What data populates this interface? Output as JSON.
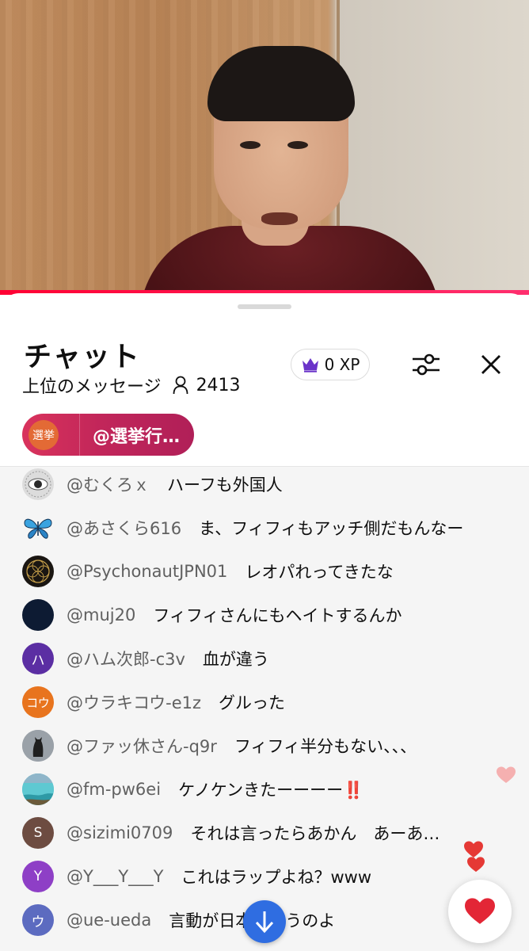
{
  "colors": {
    "accent": "#ff0033",
    "pinned": "#c2265a",
    "scroll_button": "#2f6de1",
    "heart": "#e32636"
  },
  "chat": {
    "title": "チャット",
    "mode": "上位のメッセージ",
    "viewer_count": "2413",
    "xp_label": "0 XP",
    "pinned": {
      "badge": "選挙",
      "text": "@選挙行…"
    }
  },
  "messages": [
    {
      "avatar": "eye-photo",
      "author": "@むくろｘ",
      "text": "ハーフも外国人"
    },
    {
      "avatar": "butterfly",
      "author": "@あさくら616",
      "text": "ま、フィフィもアッチ側だもんなー"
    },
    {
      "avatar": "mandala",
      "author": "@PsychonautJPN01",
      "text": "レオパれってきたな"
    },
    {
      "avatar": "dark-circle",
      "author": "@muj20",
      "text": "フィフィさんにもヘイトするんか"
    },
    {
      "avatar_letter": "ハ",
      "avatar_color": "#5b2ea3",
      "author": "@ハム次郎-c3v",
      "text": "血が違う"
    },
    {
      "avatar_letter": "コウ",
      "avatar_color": "#e8741e",
      "author": "@ウラキコウ-e1z",
      "text": "グルった"
    },
    {
      "avatar": "cat-photo",
      "author": "@ファッ休さん-q9r",
      "text": "フィフィ半分もない、、、"
    },
    {
      "avatar": "sea-photo",
      "author": "@fm-pw6ei",
      "text": "ケノケンきたーーーー",
      "emoji": "‼️"
    },
    {
      "avatar_letter": "S",
      "avatar_color": "#6d4c41",
      "author": "@sizimi0709",
      "text": "それは言ったらあかん　あーあ…"
    },
    {
      "avatar_letter": "Y",
      "avatar_color": "#8e3fc6",
      "author": "@Y___Y___Y",
      "text": "これはラップよね？www"
    },
    {
      "avatar_letter": "ウ",
      "avatar_color": "#5c6bc0",
      "author": "@ue-ueda",
      "text": "言動が日本ちゃうのよ"
    }
  ]
}
